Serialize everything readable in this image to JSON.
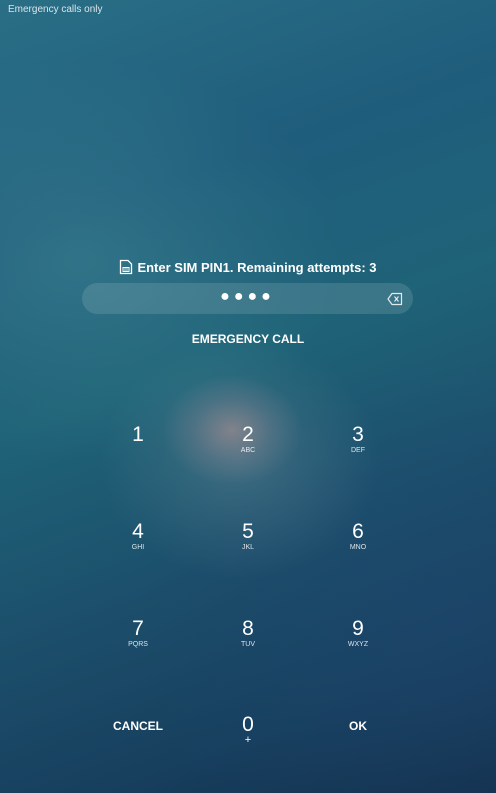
{
  "status_bar": {
    "text": "Emergency calls only"
  },
  "prompt": {
    "icon": "sim-card-icon",
    "text": "Enter SIM PIN1. Remaining attempts: 3"
  },
  "pin_input": {
    "masked_value": "●●●●",
    "digits_entered": 4,
    "backspace_icon": "backspace-icon"
  },
  "emergency_call": {
    "label": "EMERGENCY CALL"
  },
  "keypad": {
    "k1": {
      "digit": "1",
      "letters": ""
    },
    "k2": {
      "digit": "2",
      "letters": "ABC"
    },
    "k3": {
      "digit": "3",
      "letters": "DEF"
    },
    "k4": {
      "digit": "4",
      "letters": "GHI"
    },
    "k5": {
      "digit": "5",
      "letters": "JKL"
    },
    "k6": {
      "digit": "6",
      "letters": "MNO"
    },
    "k7": {
      "digit": "7",
      "letters": "PQRS"
    },
    "k8": {
      "digit": "8",
      "letters": "TUV"
    },
    "k9": {
      "digit": "9",
      "letters": "WXYZ"
    },
    "k0": {
      "digit": "0",
      "letters": "+"
    },
    "cancel": {
      "label": "CANCEL"
    },
    "ok": {
      "label": "OK"
    }
  },
  "colors": {
    "text": "#ffffff",
    "field_bg": "rgba(255,255,255,0.12)"
  }
}
